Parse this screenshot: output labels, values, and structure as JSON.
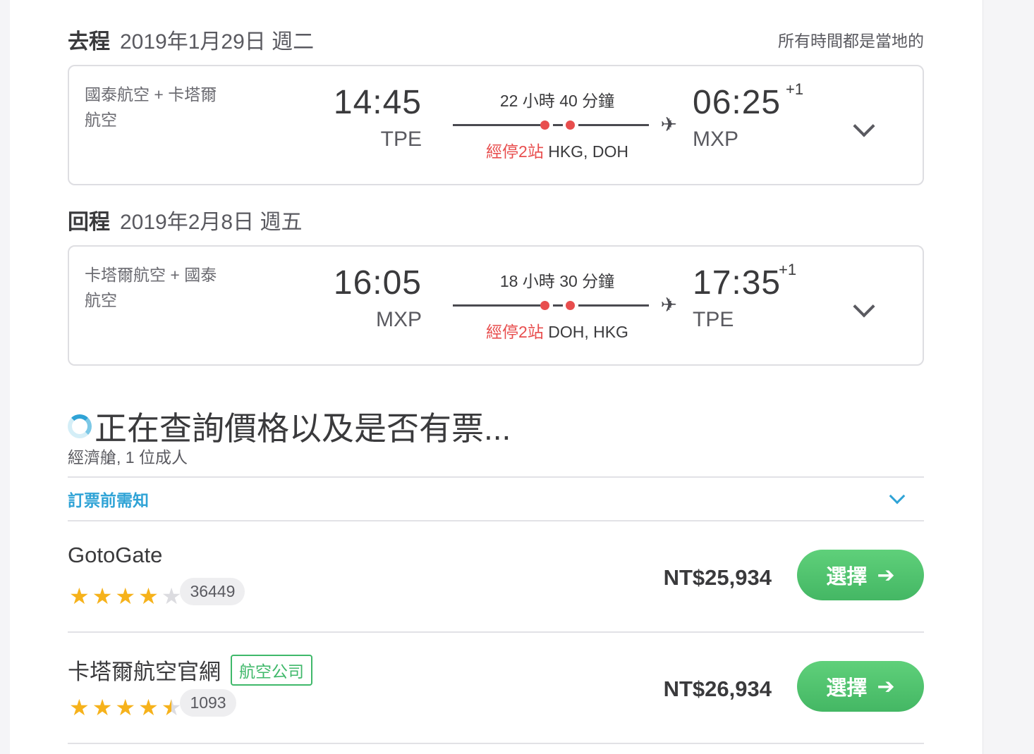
{
  "timezone_note": "所有時間都是當地的",
  "legs": [
    {
      "label": "去程",
      "date": "2019年1月29日 週二",
      "airline": "國泰航空 + 卡塔爾航空",
      "dep_time": "14:45",
      "dep_code": "TPE",
      "duration": "22 小時 40 分鐘",
      "stops_count": "經停2站",
      "stops_airports": "HKG, DOH",
      "arr_time": "06:25",
      "arr_day_offset": "+1",
      "arr_code": "MXP"
    },
    {
      "label": "回程",
      "date": "2019年2月8日 週五",
      "airline": "卡塔爾航空 + 國泰航空",
      "dep_time": "16:05",
      "dep_code": "MXP",
      "duration": "18 小時 30 分鐘",
      "stops_count": "經停2站",
      "stops_airports": "DOH, HKG",
      "arr_time": "17:35",
      "arr_day_offset": "+1",
      "arr_code": "TPE"
    }
  ],
  "loading_text": "正在查詢價格以及是否有票...",
  "cabin_info": "經濟艙, 1 位成人",
  "notice_label": "訂票前需知",
  "offers": [
    {
      "seller": "GotoGate",
      "badge": "",
      "rating": 4,
      "review_count": "36449",
      "price": "NT$25,934",
      "button_label": "選擇"
    },
    {
      "seller": "卡塔爾航空官網",
      "badge": "航空公司",
      "rating": 4.5,
      "review_count": "1093",
      "price": "NT$26,934",
      "button_label": "選擇"
    }
  ],
  "colors": {
    "accent": "#2fa3d6",
    "stop": "#e84e4e",
    "button": "#4cc06d"
  }
}
